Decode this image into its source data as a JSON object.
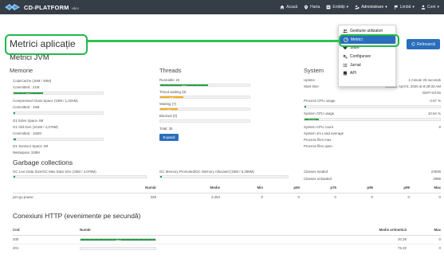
{
  "navbar": {
    "brand": "CD-PLATFORM",
    "version": "vdev",
    "items": [
      {
        "label": "Acasă",
        "icon": "home-icon"
      },
      {
        "label": "Harta",
        "icon": "map-marker-icon"
      },
      {
        "label": "Entități",
        "icon": "list-icon"
      },
      {
        "label": "Administrare",
        "icon": "users-cog-icon"
      },
      {
        "label": "Limbă",
        "icon": "flag-icon"
      },
      {
        "label": "Cont",
        "icon": "user-icon"
      }
    ]
  },
  "dropdown": {
    "items": [
      {
        "label": "Gestiune utilizatori",
        "icon": "users-icon"
      },
      {
        "label": "Metrici",
        "icon": "tachometer-icon"
      },
      {
        "label": "Stare",
        "icon": "heart-icon"
      },
      {
        "label": "Configurare",
        "icon": "cogs-icon"
      },
      {
        "label": "Jurnal",
        "icon": "tasks-icon"
      },
      {
        "label": "API",
        "icon": "book-icon"
      }
    ]
  },
  "page": {
    "title": "Metrici aplicație",
    "refresh": "Reîncarcă",
    "jvm_title": "Metrici JVM"
  },
  "memory": {
    "title": "Memorie",
    "blocks": [
      {
        "label": "CodeCache (16M / 48M)",
        "committed": "Committed : 21M",
        "pct": 0.33,
        "bar_text": "33%"
      },
      {
        "label": "Compressed Class Space (15M / 1,024M)",
        "committed": "Committed : 16M",
        "pct": 0.015,
        "bar_text": ""
      },
      {
        "label": "G1 Eden Space 4M",
        "committed": "",
        "pct": null,
        "bar_text": ""
      },
      {
        "label": "G1 Old Gen (101M / 4,078M)",
        "committed": "Committed : 182M",
        "pct": 0.025,
        "bar_text": ""
      },
      {
        "label": "G1 Survivor Space 1M",
        "committed": "",
        "pct": null,
        "bar_text": ""
      },
      {
        "label": "Metaspace 108M",
        "committed": "",
        "pct": null,
        "bar_text": ""
      }
    ]
  },
  "threads": {
    "title": "Threads",
    "items": [
      {
        "label": "Runnable 19",
        "pct": 0.54,
        "bar_text": "54%",
        "type": "ok"
      },
      {
        "label": "Timed waiting (9)",
        "pct": 0.26,
        "bar_text": "26%",
        "type": "warn"
      },
      {
        "label": "Waiting (7)",
        "pct": 0.2,
        "bar_text": "20%",
        "type": "warn"
      },
      {
        "label": "Blocked (0)",
        "pct": 0.0,
        "bar_text": "",
        "type": "ok"
      }
    ],
    "total": "Total: 35",
    "expand": "Expand"
  },
  "system": {
    "title": "System",
    "rows": [
      {
        "label": "Uptime",
        "value": "1 minute 25 seconds"
      },
      {
        "label": "Start time",
        "value": "Sunday, April 6, 2025 at 8:28:33 AM"
      },
      {
        "label": "",
        "value": "GMT+03:00"
      },
      {
        "label": "Process CPU usage",
        "value": "0.57 %"
      },
      {
        "label": "System CPU usage",
        "value": "10.64 %"
      },
      {
        "label": "System CPU count",
        "value": "8"
      },
      {
        "label": "System 1m Load average",
        "value": ""
      },
      {
        "label": "Process files max",
        "value": ""
      },
      {
        "label": "Process files open",
        "value": ""
      }
    ],
    "process_cpu_pct": 0.0057,
    "system_cpu_pct": 0.1064,
    "system_cpu_text": "10.64%"
  },
  "gc": {
    "title": "Garbage collections",
    "live_label": "GC Live Data Size/GC Max Data Size (33M / 4,078M)",
    "live_pct": 0.008,
    "promoted_label": "GC Memory Promoted/GC Memory Allocated (25M / 6,298M)",
    "promoted_pct": 0.004,
    "classes": [
      {
        "label": "Classes loaded",
        "value": "23939"
      },
      {
        "label": "Classes unloaded",
        "value": "2999"
      }
    ],
    "headers": [
      "",
      "Număr",
      "Medie",
      "Min",
      "p50",
      "p75",
      "p95",
      "p99",
      "Max"
    ],
    "rows": [
      [
        "jvm.gc.pause",
        "328",
        "3.454",
        "0",
        "0",
        "0",
        "0",
        "0",
        "0"
      ]
    ]
  },
  "http": {
    "title": "Conexiuni HTTP (evenimente pe secundă)",
    "headers": [
      "Cod",
      "Număr",
      "Medie aritmetică",
      "Max"
    ],
    "rows": [
      {
        "code": "200",
        "pct": 1.0,
        "bar_text": "100%",
        "avg": "20.29",
        "max": "0"
      },
      {
        "code": "201",
        "pct": 0.0,
        "bar_text": "",
        "avg": "75.32",
        "max": "0"
      }
    ]
  }
}
